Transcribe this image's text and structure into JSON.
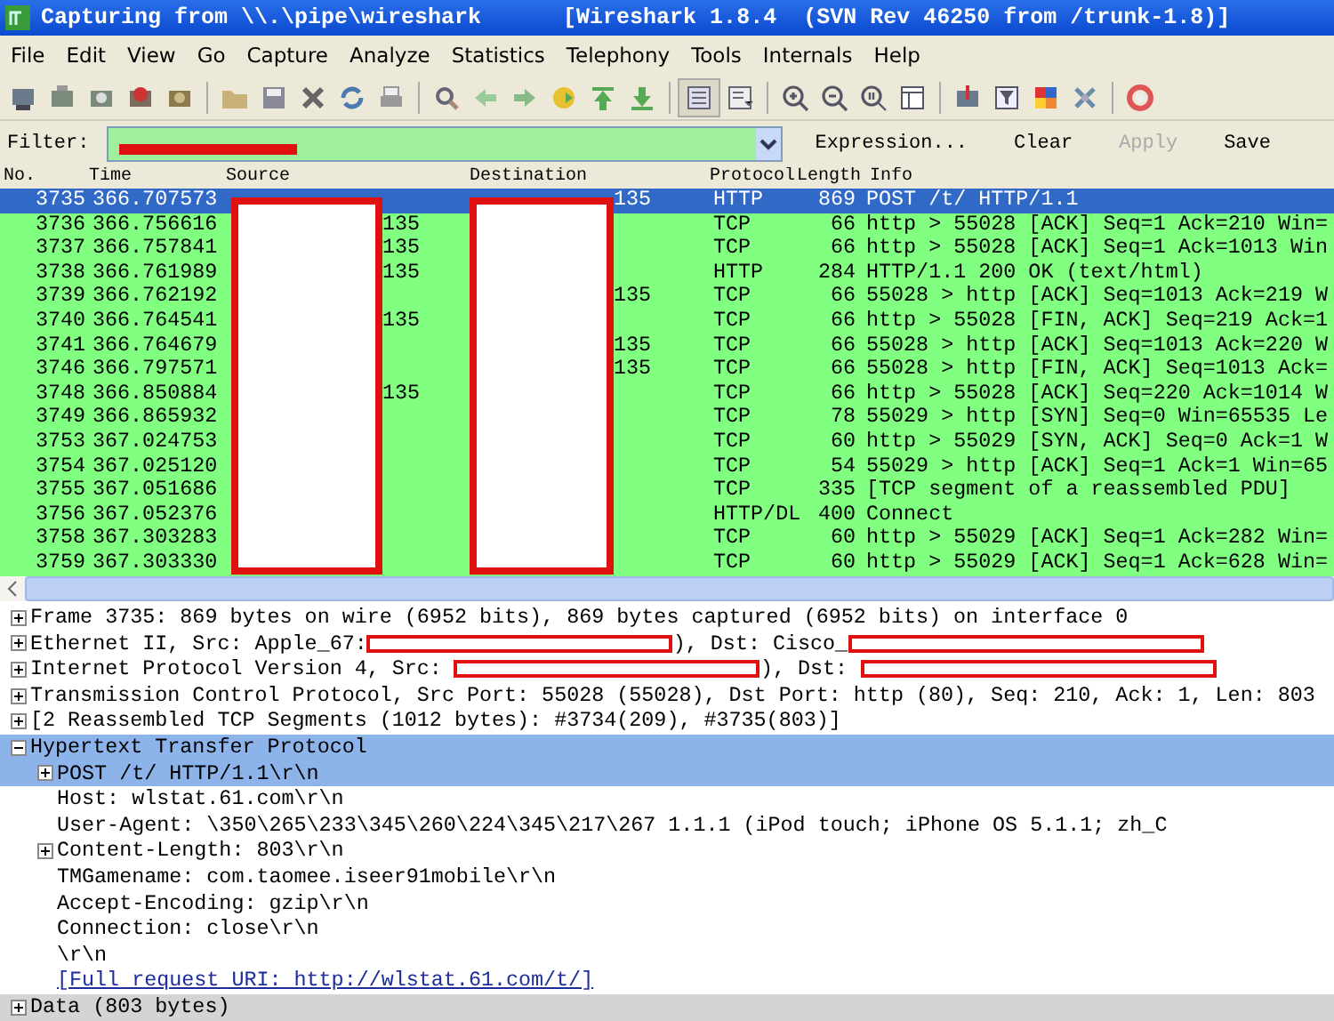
{
  "window": {
    "title": "Capturing from \\\\.\\pipe\\wireshark",
    "subtitle": "[Wireshark 1.8.4  (SVN Rev 46250 from /trunk-1.8)]"
  },
  "menu": [
    "File",
    "Edit",
    "View",
    "Go",
    "Capture",
    "Analyze",
    "Statistics",
    "Telephony",
    "Tools",
    "Internals",
    "Help"
  ],
  "filter": {
    "label": "Filter:",
    "buttons": [
      {
        "label": "Expression...",
        "disabled": false
      },
      {
        "label": "Clear",
        "disabled": false
      },
      {
        "label": "Apply",
        "disabled": true
      },
      {
        "label": "Save",
        "disabled": false
      }
    ]
  },
  "packet_list": {
    "columns": [
      "No.",
      "Time",
      "Source",
      "Destination",
      "Protocol",
      "Length",
      "Info"
    ],
    "rows": [
      {
        "no": "3735",
        "time": "366.707573",
        "destination": "135",
        "protocol": "HTTP",
        "length": "869",
        "info": "POST /t/ HTTP/1.1",
        "selected": true
      },
      {
        "no": "3736",
        "time": "366.756616",
        "source": "135",
        "protocol": "TCP",
        "length": "66",
        "info": "http > 55028 [ACK] Seq=1 Ack=210 Win=",
        "selected": false
      },
      {
        "no": "3737",
        "time": "366.757841",
        "source": "135",
        "protocol": "TCP",
        "length": "66",
        "info": "http > 55028 [ACK] Seq=1 Ack=1013 Win",
        "selected": false
      },
      {
        "no": "3738",
        "time": "366.761989",
        "source": "135",
        "protocol": "HTTP",
        "length": "284",
        "info": "HTTP/1.1 200 OK  (text/html)",
        "selected": false
      },
      {
        "no": "3739",
        "time": "366.762192",
        "destination": "135",
        "protocol": "TCP",
        "length": "66",
        "info": "55028 > http [ACK] Seq=1013 Ack=219 W",
        "selected": false
      },
      {
        "no": "3740",
        "time": "366.764541",
        "source": "135",
        "protocol": "TCP",
        "length": "66",
        "info": "http > 55028 [FIN, ACK] Seq=219 Ack=1",
        "selected": false
      },
      {
        "no": "3741",
        "time": "366.764679",
        "destination": "135",
        "protocol": "TCP",
        "length": "66",
        "info": "55028 > http [ACK] Seq=1013 Ack=220 W",
        "selected": false
      },
      {
        "no": "3746",
        "time": "366.797571",
        "destination": "135",
        "protocol": "TCP",
        "length": "66",
        "info": "55028 > http [FIN, ACK] Seq=1013 Ack=",
        "selected": false
      },
      {
        "no": "3748",
        "time": "366.850884",
        "source": "135",
        "protocol": "TCP",
        "length": "66",
        "info": "http > 55028 [ACK] Seq=220 Ack=1014 W",
        "selected": false
      },
      {
        "no": "3749",
        "time": "366.865932",
        "protocol": "TCP",
        "length": "78",
        "info": "55029 > http [SYN] Seq=0 Win=65535 Le",
        "selected": false
      },
      {
        "no": "3753",
        "time": "367.024753",
        "protocol": "TCP",
        "length": "60",
        "info": "http > 55029 [SYN, ACK] Seq=0 Ack=1 W",
        "selected": false
      },
      {
        "no": "3754",
        "time": "367.025120",
        "protocol": "TCP",
        "length": "54",
        "info": "55029 > http [ACK] Seq=1 Ack=1 Win=65",
        "selected": false
      },
      {
        "no": "3755",
        "time": "367.051686",
        "protocol": "TCP",
        "length": "335",
        "info": "[TCP segment of a reassembled PDU]",
        "selected": false
      },
      {
        "no": "3756",
        "time": "367.052376",
        "protocol": "HTTP/DL",
        "length": "400",
        "info": "Connect",
        "selected": false
      },
      {
        "no": "3758",
        "time": "367.303283",
        "protocol": "TCP",
        "length": "60",
        "info": "http > 55029 [ACK] Seq=1 Ack=282 Win=",
        "selected": false
      },
      {
        "no": "3759",
        "time": "367.303330",
        "protocol": "TCP",
        "length": "60",
        "info": "http > 55029 [ACK] Seq=1 Ack=628 Win=",
        "selected": false
      }
    ]
  },
  "details": [
    {
      "parts": [
        {
          "kind": "text",
          "text": "Frame 3735: 869 bytes on wire (6952 bits), 869 bytes captured (6952 bits) on interface 0"
        }
      ],
      "expanded": false,
      "selected": false
    },
    {
      "parts": [
        {
          "kind": "text",
          "text": "Ethernet II, Src: Apple_67:"
        },
        {
          "kind": "redacted"
        },
        {
          "kind": "text",
          "text": "), Dst: Cisco_"
        },
        {
          "kind": "redacted"
        }
      ],
      "expanded": false,
      "selected": false
    },
    {
      "parts": [
        {
          "kind": "text",
          "text": "Internet Protocol Version 4, Src: "
        },
        {
          "kind": "redacted"
        },
        {
          "kind": "text",
          "text": "), Dst: "
        },
        {
          "kind": "redacted"
        }
      ],
      "expanded": false,
      "selected": false
    },
    {
      "parts": [
        {
          "kind": "text",
          "text": "Transmission Control Protocol, Src Port: 55028 (55028), Dst Port: http (80), Seq: 210, Ack: 1, Len: 803"
        }
      ],
      "expanded": false,
      "selected": false
    },
    {
      "parts": [
        {
          "kind": "text",
          "text": "[2 Reassembled TCP Segments (1012 bytes): #3734(209), #3735(803)]"
        }
      ],
      "expanded": false,
      "selected": false
    },
    {
      "parts": [
        {
          "kind": "text",
          "text": "Hypertext Transfer Protocol"
        }
      ],
      "expanded": true,
      "selected": true,
      "children": [
        {
          "parts": [
            {
              "kind": "text",
              "text": "POST /t/ HTTP/1.1\\r\\n"
            }
          ],
          "expanded": false,
          "selected": true
        },
        {
          "parts": [
            {
              "kind": "text",
              "text": "Host: wlstat.61.com\\r\\n"
            }
          ],
          "selected": false
        },
        {
          "parts": [
            {
              "kind": "text",
              "text": "User-Agent: \\350\\265\\233\\345\\260\\224\\345\\217\\267 1.1.1 (iPod touch; iPhone OS 5.1.1; zh_C"
            }
          ],
          "selected": false
        },
        {
          "parts": [
            {
              "kind": "text",
              "text": "Content-Length: 803\\r\\n"
            }
          ],
          "expanded": false,
          "selected": false
        },
        {
          "parts": [
            {
              "kind": "text",
              "text": "TMGamename: com.taomee.iseer91mobile\\r\\n"
            }
          ],
          "selected": false
        },
        {
          "parts": [
            {
              "kind": "text",
              "text": "Accept-Encoding: gzip\\r\\n"
            }
          ],
          "selected": false
        },
        {
          "parts": [
            {
              "kind": "text",
              "text": "Connection: close\\r\\n"
            }
          ],
          "selected": false
        },
        {
          "parts": [
            {
              "kind": "text",
              "text": "\\r\\n"
            }
          ],
          "selected": false
        },
        {
          "parts": [
            {
              "kind": "link",
              "text": "[Full request URI: http://wlstat.61.com/t/]"
            }
          ],
          "selected": false
        }
      ]
    },
    {
      "parts": [
        {
          "kind": "text",
          "text": "Data (803 bytes)"
        }
      ],
      "expanded": false,
      "selected": false,
      "shaded": true
    }
  ]
}
